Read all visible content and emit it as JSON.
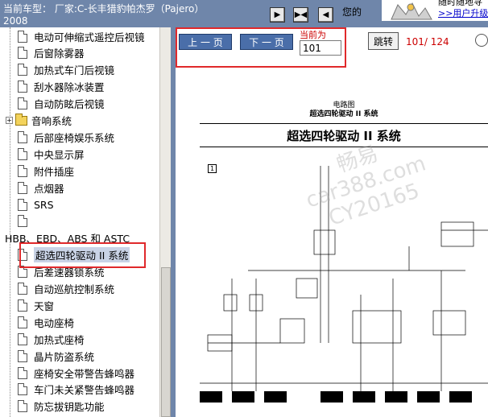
{
  "header": {
    "vehicle_label": "当前车型：  厂家:C-长丰猎豹帕杰罗（Pajero）",
    "vehicle_year": "2008",
    "welcome": "您的",
    "promo_top": "随时随地寻",
    "promo_link": ">>用户升级",
    "nav_first_icon": "skip-first-icon",
    "nav_middle_icon": "split-icon",
    "nav_back_icon": "play-back-icon"
  },
  "sidebar": {
    "items": [
      {
        "label": "电动可伸缩式遥控后视镜",
        "type": "doc"
      },
      {
        "label": "后窗除雾器",
        "type": "doc"
      },
      {
        "label": "加热式车门后视镜",
        "type": "doc"
      },
      {
        "label": "刮水器除冰装置",
        "type": "doc"
      },
      {
        "label": "自动防眩后视镜",
        "type": "doc"
      },
      {
        "label": "音响系统",
        "type": "folder"
      },
      {
        "label": "后部座椅娱乐系统",
        "type": "doc"
      },
      {
        "label": "中央显示屏",
        "type": "doc"
      },
      {
        "label": "附件插座",
        "type": "doc"
      },
      {
        "label": "点烟器",
        "type": "doc"
      },
      {
        "label": "SRS",
        "type": "doc"
      },
      {
        "label": "",
        "type": "doc"
      },
      {
        "label": "HBB、EBD、ABS 和 ASTC",
        "type": "plain"
      },
      {
        "label": "超选四轮驱动 II 系统",
        "type": "doc",
        "selected": true
      },
      {
        "label": "后差速器锁系统",
        "type": "doc"
      },
      {
        "label": "自动巡航控制系统",
        "type": "doc"
      },
      {
        "label": "天窗",
        "type": "doc"
      },
      {
        "label": "电动座椅",
        "type": "doc"
      },
      {
        "label": "加热式座椅",
        "type": "doc"
      },
      {
        "label": "晶片防盗系统",
        "type": "doc"
      },
      {
        "label": "座椅安全带警告蜂鸣器",
        "type": "doc"
      },
      {
        "label": "车门未关紧警告蜂鸣器",
        "type": "doc"
      },
      {
        "label": "防忘拔钥匙功能",
        "type": "doc"
      },
      {
        "label": "",
        "type": "doc"
      }
    ]
  },
  "toolbar": {
    "prev_label": "上 一 页",
    "next_label": "下 一 页",
    "current_label": "当前为",
    "page_value": "101",
    "jump_label": "跳转",
    "page_counter": "101/ 124"
  },
  "diagram": {
    "header_line1": "电路图",
    "header_line2": "超选四轮驱动 II 系统",
    "title": "超选四轮驱动 II 系统",
    "section_number": "1",
    "watermark_line1": "畅易",
    "watermark_line2": "car388.com",
    "watermark_line3": "CY20165"
  },
  "colors": {
    "topbar": "#6f86aa",
    "button": "#4a6ea9",
    "highlight": "#e0292b",
    "counter_text": "#cc0000"
  }
}
